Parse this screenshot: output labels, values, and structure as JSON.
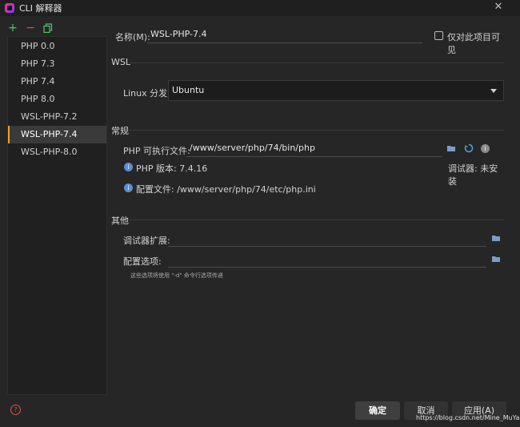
{
  "window": {
    "title": "CLI 解释器",
    "close_glyph": "✕"
  },
  "toolbar": {
    "add_glyph": "+",
    "remove_glyph": "−"
  },
  "interpreters": [
    {
      "label": "PHP 0.0",
      "selected": false
    },
    {
      "label": "PHP 7.3",
      "selected": false
    },
    {
      "label": "PHP 7.4",
      "selected": false
    },
    {
      "label": "PHP 8.0",
      "selected": false
    },
    {
      "label": "WSL-PHP-7.2",
      "selected": false
    },
    {
      "label": "WSL-PHP-7.4",
      "selected": true
    },
    {
      "label": "WSL-PHP-8.0",
      "selected": false
    }
  ],
  "form": {
    "name_label": "名称(M):",
    "name_value": "WSL-PHP-7.4",
    "visible_only_label": "仅对此项目可见",
    "visible_only_checked": false,
    "wsl_section": "WSL",
    "distro_label": "Linux 分发:",
    "distro_value": "Ubuntu",
    "general_section": "常规",
    "exe_label": "PHP 可执行文件:",
    "exe_value": "/www/server/php/74/bin/php",
    "php_version": "PHP 版本: 7.4.16",
    "debugger_status": "调试器: 未安装",
    "config_file": "配置文件: /www/server/php/74/etc/php.ini",
    "other_section": "其他",
    "debugger_ext_label": "调试器扩展:",
    "debugger_ext_value": "",
    "config_options_label": "配置选项:",
    "config_options_value": "",
    "config_hint": "这些选项将使用 \"-d\" 命令行选项传递"
  },
  "buttons": {
    "ok": "确定",
    "cancel": "取消",
    "apply": "应用(A)",
    "help_glyph": "?"
  },
  "watermark": "https://blog.csdn.net/Mine_MuYan",
  "colors": {
    "accent_selected": "#f0a02a",
    "add": "#4cc96a",
    "remove": "#e0524a",
    "info": "#5a8fd8"
  }
}
